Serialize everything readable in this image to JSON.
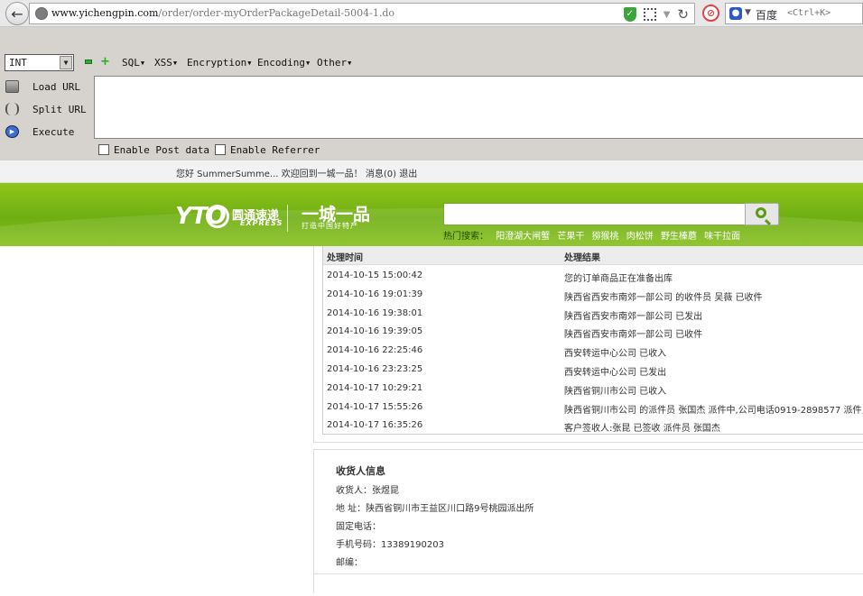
{
  "browser": {
    "url_host": "www.yichengpin.com",
    "url_path": "/order/order-myOrderPackageDetail-5004-1.do",
    "search_engine": "百度",
    "search_placeholder": "<Ctrl+K>"
  },
  "hackbar": {
    "select_value": "INT",
    "menus": [
      "SQL",
      "XSS",
      "Encryption",
      "Encoding",
      "Other"
    ],
    "load_url": "Load URL",
    "split_url": "Split URL",
    "execute": "Execute",
    "enable_post": "Enable Post data",
    "enable_referrer": "Enable Referrer"
  },
  "site": {
    "greeting": "您好 SummerSumme... 欢迎回到一城一品！",
    "messages_link": "消息(0)",
    "logout_link": "退出",
    "yto_logo": "YTO",
    "yto_cn": "圆通速递",
    "yto_en": "EXPRESS",
    "brand": "一城一品",
    "brand_tagline": "打造中国好特产",
    "hot_label": "热门搜索：",
    "hot_items": [
      "阳澄湖大闸蟹",
      "芒果干",
      "猕猴桃",
      "肉松饼",
      "野生榛蘑",
      "味干拉面"
    ]
  },
  "tracking": {
    "col_time": "处理时间",
    "col_result": "处理结果",
    "rows": [
      {
        "time": "2014-10-15 15:00:42",
        "result": "您的订单商品正在准备出库"
      },
      {
        "time": "2014-10-16 19:01:39",
        "result": "陕西省西安市南郊一部公司 的收件员 吴薇 已收件"
      },
      {
        "time": "2014-10-16 19:38:01",
        "result": "陕西省西安市南郊一部公司 已发出"
      },
      {
        "time": "2014-10-16 19:39:05",
        "result": "陕西省西安市南郊一部公司 已收件"
      },
      {
        "time": "2014-10-16 22:25:46",
        "result": "西安转运中心公司 已收入"
      },
      {
        "time": "2014-10-16 23:23:25",
        "result": "西安转运中心公司 已发出"
      },
      {
        "time": "2014-10-17 10:29:21",
        "result": "陕西省铜川市公司 已收入"
      },
      {
        "time": "2014-10-17 15:55:26",
        "result": "陕西省铜川市公司 的派件员 张国杰 派件中,公司电话0919-2898577 派件员电"
      },
      {
        "time": "2014-10-17 16:35:26",
        "result": "客户签收人:张昆 已签收 派件员 张国杰"
      }
    ]
  },
  "receiver": {
    "title": "收货人信息",
    "name": "收货人：张煜昆",
    "address": "地 址：陕西省铜川市王益区川口路9号桃园派出所",
    "phone": "固定电话：",
    "mobile": "手机号码：13389190203",
    "zip": "邮编："
  }
}
